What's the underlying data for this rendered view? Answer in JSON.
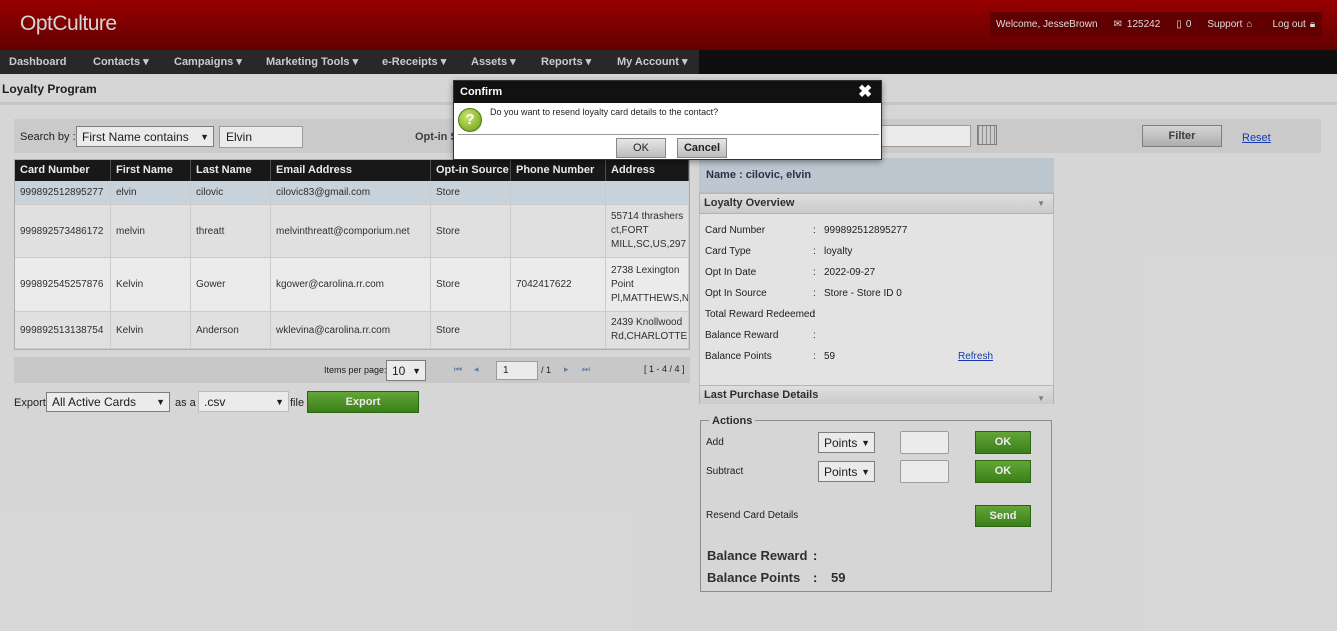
{
  "app": {
    "logo": "OptCulture"
  },
  "userbar": {
    "welcome": "Welcome, JesseBrown",
    "email_count": "125242",
    "sms_count": "0",
    "support": "Support",
    "logout": "Log out"
  },
  "nav": [
    "Dashboard",
    "Contacts ▾",
    "Campaigns ▾",
    "Marketing Tools ▾",
    "e-Receipts ▾",
    "Assets ▾",
    "Reports ▾",
    "My Account ▾"
  ],
  "page": {
    "title": "Loyalty Program"
  },
  "search": {
    "label": "Search by :",
    "field": "First Name contains",
    "value": "Elvin",
    "optin_label": "Opt-in S",
    "filter": "Filter",
    "reset": "Reset"
  },
  "table": {
    "headers": [
      "Card Number",
      "First Name",
      "Last Name",
      "Email Address",
      "Opt-in Source",
      "Phone Number",
      "Address"
    ],
    "rows": [
      [
        "999892512895277",
        "elvin",
        "cilovic",
        "cilovic83@gmail.com",
        "Store",
        "",
        ""
      ],
      [
        "999892573486172",
        "melvin",
        "threatt",
        "melvinthreatt@comporium.net",
        "Store",
        "",
        "55714 thrashers ct,FORT MILL,SC,US,297"
      ],
      [
        "999892545257876",
        "Kelvin",
        "Gower",
        "kgower@carolina.rr.com",
        "Store",
        "7042417622",
        "2738 Lexington Point Pl,MATTHEWS,N"
      ],
      [
        "999892513138754",
        "Kelvin",
        "Anderson",
        "wklevina@carolina.rr.com",
        "Store",
        "",
        "2439 Knollwood Rd,CHARLOTTE"
      ]
    ]
  },
  "pager": {
    "items_label": "Items per page:",
    "per_page": "10",
    "page": "1",
    "of": "/ 1",
    "range": "[ 1 - 4 / 4 ]"
  },
  "export": {
    "label": "Export",
    "cards": "All Active Cards",
    "as": "as a",
    "format": ".csv",
    "file": "file",
    "button": "Export"
  },
  "detail": {
    "name": "Name : cilovic, elvin",
    "overview_title": "Loyalty Overview",
    "rows": [
      {
        "k": "Card Number",
        "v": "999892512895277"
      },
      {
        "k": "Card Type",
        "v": "loyalty"
      },
      {
        "k": "Opt In Date",
        "v": "2022-09-27"
      },
      {
        "k": "Opt In Source",
        "v": "Store - Store ID 0"
      },
      {
        "k": "Total Reward Redeemed",
        "v": ""
      },
      {
        "k": "Balance Reward",
        "v": ""
      },
      {
        "k": "Balance Points",
        "v": "59"
      }
    ],
    "refresh": "Refresh",
    "purchase_title": "Last Purchase Details"
  },
  "actions": {
    "legend": "Actions",
    "add": "Add",
    "subtract": "Subtract",
    "unit": "Points",
    "ok": "OK",
    "resend": "Resend Card Details",
    "send": "Send",
    "balance_reward_label": "Balance Reward",
    "balance_points_label": "Balance Points",
    "balance_points": "59",
    "colon": ":"
  },
  "dialog": {
    "title": "Confirm",
    "message": "Do you want to resend loyalty card details to the contact?",
    "ok": "OK",
    "cancel": "Cancel"
  }
}
